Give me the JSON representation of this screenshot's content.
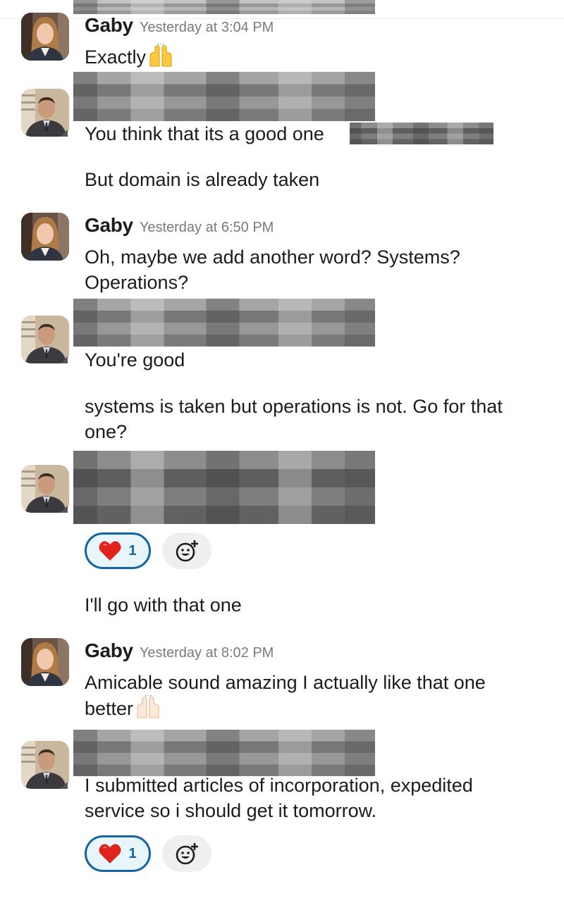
{
  "messages": [
    {
      "sender": "Gaby",
      "time": "Yesterday at 3:04 PM",
      "text": "Exactly",
      "emoji": "raised-hands-yellow"
    },
    {
      "lines": [
        "You think that its a good one",
        "But domain is already taken"
      ]
    },
    {
      "sender": "Gaby",
      "time": "Yesterday at 6:50 PM",
      "lines": [
        "Oh, maybe we add another word? Systems?",
        "Operations?"
      ]
    },
    {
      "lines": [
        "You're good",
        "systems is taken but operations is not. Go for that",
        "one?"
      ]
    },
    {
      "reaction": {
        "emoji": "heart",
        "count": "1"
      },
      "text": "I'll go with that one"
    },
    {
      "sender": "Gaby",
      "time": "Yesterday at 8:02 PM",
      "lines": [
        "Amicable sound amazing I actually like that one",
        "better"
      ],
      "emoji": "raised-hands-light"
    },
    {
      "lines": [
        "I submitted articles of incorporation, expedited",
        "service so i should get it tomorrow."
      ],
      "reaction": {
        "emoji": "heart",
        "count": "1"
      }
    }
  ],
  "icons": {
    "add_reaction": "add-reaction-icon",
    "reaction": "heart-icon"
  },
  "colors": {
    "reaction_border": "#1264a3",
    "reaction_bg": "#e8f5fa",
    "heart": "#e0241b"
  }
}
